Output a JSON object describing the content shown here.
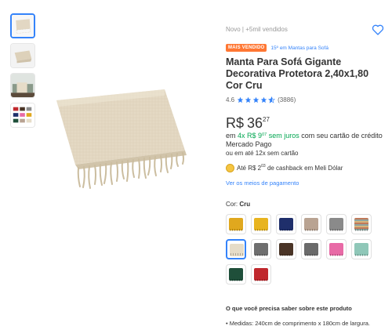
{
  "meta": {
    "condition": "Novo",
    "separator": "|",
    "sold": "+5mil vendidos"
  },
  "badges": {
    "best_seller": "MAIS VENDIDO",
    "rank": "15º em Mantas para Sofá"
  },
  "product": {
    "title": "Manta Para Sofá Gigante Decorativa Protetora 2,40x1,80 Cor Cru"
  },
  "rating": {
    "score": "4.6",
    "stars": 4.6,
    "count": "(3886)"
  },
  "price": {
    "currency": "R$",
    "integer": "36",
    "cents": "27"
  },
  "installments": {
    "prefix": "em",
    "offer": "4x R$ 9",
    "offer_cents": "07",
    "interest": "sem juros",
    "suffix": "com seu cartão de crédito Mercado Pago",
    "alt": "ou em até 12x sem cartão"
  },
  "cashback": {
    "prefix": "Até R$ 2",
    "cents": "03",
    "suffix": "de cashback em Meli Dólar"
  },
  "payments_link": "Ver os meios de pagamento",
  "color": {
    "label": "Cor:",
    "selected": "Cru"
  },
  "swatches": [
    {
      "name": "mostarda",
      "color": "#e0a81e"
    },
    {
      "name": "amarelo",
      "color": "#e8b41f"
    },
    {
      "name": "azul-marinho",
      "color": "#1f2f6b"
    },
    {
      "name": "bege",
      "color": "#b9a392"
    },
    {
      "name": "cinza",
      "color": "#8a8a8a"
    },
    {
      "name": "listrado",
      "color": "#c07a5a"
    },
    {
      "name": "cru",
      "color": "#e6dcc8"
    },
    {
      "name": "mesclado",
      "color": "#6e6e6e"
    },
    {
      "name": "marrom",
      "color": "#4a3426"
    },
    {
      "name": "cinza-escuro",
      "color": "#6a6a6a"
    },
    {
      "name": "rosa",
      "color": "#e86aa6"
    },
    {
      "name": "verde-agua",
      "color": "#8fc7b8"
    },
    {
      "name": "verde-escuro",
      "color": "#1f4f3a"
    },
    {
      "name": "vermelho",
      "color": "#c0282d"
    }
  ],
  "info": {
    "title": "O que você precisa saber sobre este produto",
    "items": [
      "Medidas: 240cm de comprimento x 180cm de largura."
    ]
  },
  "thumbnails": [
    {
      "name": "manta-cru"
    },
    {
      "name": "manta-dobrada"
    },
    {
      "name": "sofa-ambiente"
    },
    {
      "name": "cores-variadas"
    }
  ],
  "colors": {
    "accent": "#3483fa",
    "badge": "#ff7733",
    "green": "#00a650"
  }
}
